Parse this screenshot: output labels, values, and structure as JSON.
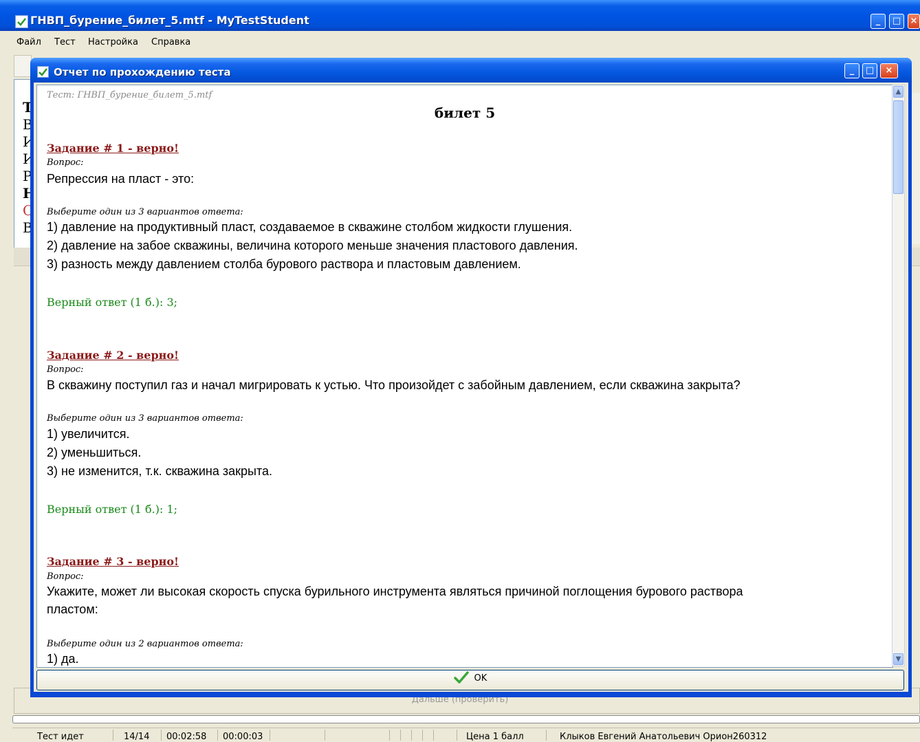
{
  "main_window": {
    "title": "ГНВП_бурение_билет_5.mtf - MyTestStudent",
    "menu": [
      "Файл",
      "Тест",
      "Настройка",
      "Справка"
    ],
    "left_panel_letters": [
      "Т",
      "В",
      "И",
      "И",
      "Р",
      "Н",
      "С",
      "В"
    ],
    "next_button_label": "Дальше (проверить)",
    "status": {
      "state": "Тест идет",
      "progress": "14/14",
      "elapsed": "00:02:58",
      "question_time": "00:00:03",
      "price": "Цена 1 балл",
      "user": "Клыков Евгений Анатольевич Орион260312"
    }
  },
  "dialog": {
    "title": "Отчет по прохождению теста",
    "ok_label": "OK"
  },
  "report": {
    "test_name": "Тест: ГНВП_бурение_билет_5.mtf",
    "ticket": "билет 5",
    "question_label": "Вопрос:",
    "tasks": [
      {
        "header": "Задание # 1 - верно!",
        "question": "Репрессия на пласт - это:",
        "choose": "Выберите один из 3 вариантов ответа:",
        "options": [
          "1) давление на продуктивный пласт, создаваемое в скважине столбом жидкости глушения.",
          "2) давление на забое скважины, величина которого меньше значения пластового давления.",
          "3) разность между давлением столба бурового раствора и пластовым давлением."
        ],
        "correct": "Верный ответ (1 б.): 3;"
      },
      {
        "header": "Задание # 2 - верно!",
        "question": "В скважину поступил газ и начал мигрировать к устью. Что произойдет с забойным давлением, если скважина закрыта?",
        "choose": "Выберите один из 3 вариантов ответа:",
        "options": [
          "1) увеличится.",
          "2) уменьшиться.",
          "3) не изменится, т.к. скважина закрыта."
        ],
        "correct": "Верный ответ (1 б.): 1;"
      },
      {
        "header": "Задание # 3 - верно!",
        "question_line1": "Укажите, может ли высокая скорость спуска бурильного инструмента являться причиной поглощения бурового раствора",
        "question_line2": "пластом:",
        "choose": "Выберите один из 2 вариантов ответа:",
        "options": [
          "1) да."
        ]
      }
    ]
  },
  "icons": {
    "app": "checkmark-icon",
    "ok": "green-check-icon"
  }
}
